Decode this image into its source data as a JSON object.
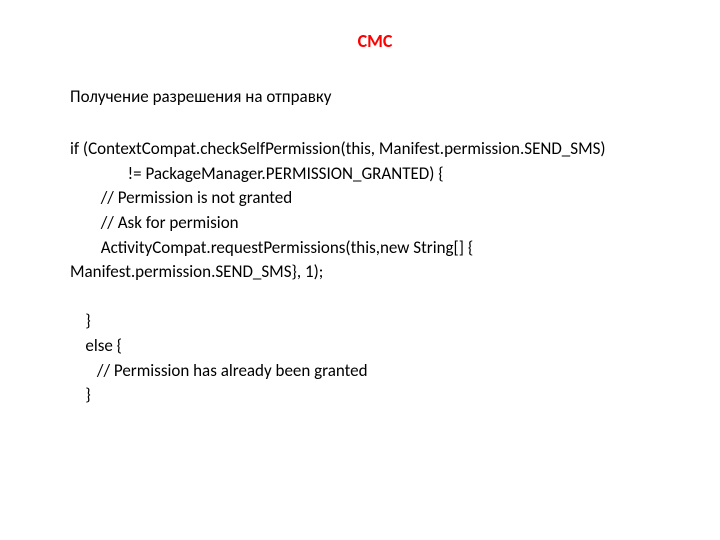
{
  "title": "СМС",
  "subtitle": "Получение разрешения на отправку",
  "code": "if (ContextCompat.checkSelfPermission(this, Manifest.permission.SEND_SMS)\n               != PackageManager.PERMISSION_GRANTED) {\n        // Permission is not granted\n        // Ask for permision\n        ActivityCompat.requestPermissions(this,new String[] {\nManifest.permission.SEND_SMS}, 1);\n\n    }\n    else {\n       // Permission has already been granted\n    }"
}
